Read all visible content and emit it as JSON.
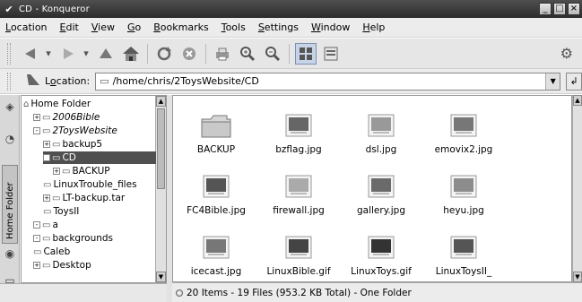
{
  "window": {
    "title": "CD - Konqueror"
  },
  "menubar": {
    "items": [
      {
        "key": "L",
        "rest": "ocation"
      },
      {
        "key": "E",
        "rest": "dit"
      },
      {
        "key": "V",
        "rest": "iew"
      },
      {
        "key": "G",
        "rest": "o"
      },
      {
        "key": "B",
        "rest": "ookmarks"
      },
      {
        "key": "T",
        "rest": "ools"
      },
      {
        "key": "S",
        "rest": "ettings"
      },
      {
        "key": "W",
        "rest": "indow"
      },
      {
        "key": "H",
        "rest": "elp"
      }
    ]
  },
  "location": {
    "label_key": "o",
    "label_pre": "L",
    "label_post": "cation:",
    "path": "/home/chris/2ToysWebsite/CD"
  },
  "tree": {
    "items": [
      {
        "label": "Home Folder",
        "indent": 0,
        "exp": "",
        "italic": false,
        "selected": false
      },
      {
        "label": "2006Bible",
        "indent": 1,
        "exp": "+",
        "italic": true,
        "selected": false
      },
      {
        "label": "2ToysWebsite",
        "indent": 1,
        "exp": "-",
        "italic": true,
        "selected": false
      },
      {
        "label": "backup5",
        "indent": 2,
        "exp": "+",
        "italic": false,
        "selected": false
      },
      {
        "label": "CD",
        "indent": 2,
        "exp": "-",
        "italic": false,
        "selected": true
      },
      {
        "label": "BACKUP",
        "indent": 3,
        "exp": "+",
        "italic": false,
        "selected": false
      },
      {
        "label": "LinuxTrouble_files",
        "indent": 2,
        "exp": "",
        "italic": false,
        "selected": false
      },
      {
        "label": "LT-backup.tar",
        "indent": 2,
        "exp": "+",
        "italic": false,
        "selected": false
      },
      {
        "label": "ToysII",
        "indent": 2,
        "exp": "",
        "italic": false,
        "selected": false
      },
      {
        "label": "a",
        "indent": 1,
        "exp": "-",
        "italic": false,
        "selected": false
      },
      {
        "label": "backgrounds",
        "indent": 1,
        "exp": "-",
        "italic": false,
        "selected": false
      },
      {
        "label": "Caleb",
        "indent": 1,
        "exp": "",
        "italic": false,
        "selected": false
      },
      {
        "label": "Desktop",
        "indent": 1,
        "exp": "+",
        "italic": false,
        "selected": false
      }
    ]
  },
  "files": {
    "items": [
      {
        "name": "BACKUP",
        "icon": "folder-icon"
      },
      {
        "name": "bzflag.jpg",
        "icon": "image-thumb-icon"
      },
      {
        "name": "dsl.jpg",
        "icon": "image-thumb-icon"
      },
      {
        "name": "emovix2.jpg",
        "icon": "image-thumb-icon"
      },
      {
        "name": "FC4Bible.jpg",
        "icon": "image-thumb-icon"
      },
      {
        "name": "firewall.jpg",
        "icon": "image-thumb-icon"
      },
      {
        "name": "gallery.jpg",
        "icon": "image-thumb-icon"
      },
      {
        "name": "heyu.jpg",
        "icon": "image-thumb-icon"
      },
      {
        "name": "icecast.jpg",
        "icon": "image-thumb-icon"
      },
      {
        "name": "LinuxBible.gif",
        "icon": "image-thumb-icon"
      },
      {
        "name": "LinuxToys.gif",
        "icon": "image-thumb-icon"
      },
      {
        "name": "LinuxToysII_",
        "icon": "image-thumb-icon"
      }
    ]
  },
  "status": {
    "text": "20 Items - 19 Files (953.2 KB Total) - One Folder"
  },
  "sidetabs": {
    "home_label": "Home Folder"
  }
}
